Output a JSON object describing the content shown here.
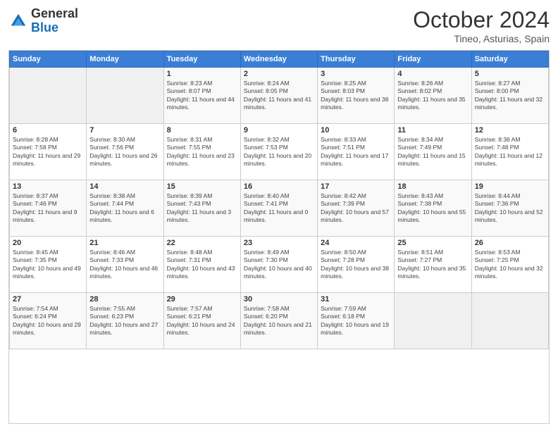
{
  "header": {
    "logo_general": "General",
    "logo_blue": "Blue",
    "month_year": "October 2024",
    "location": "Tineo, Asturias, Spain"
  },
  "days_of_week": [
    "Sunday",
    "Monday",
    "Tuesday",
    "Wednesday",
    "Thursday",
    "Friday",
    "Saturday"
  ],
  "weeks": [
    [
      {
        "day": "",
        "info": ""
      },
      {
        "day": "",
        "info": ""
      },
      {
        "day": "1",
        "info": "Sunrise: 8:23 AM\nSunset: 8:07 PM\nDaylight: 11 hours and 44 minutes."
      },
      {
        "day": "2",
        "info": "Sunrise: 8:24 AM\nSunset: 8:05 PM\nDaylight: 11 hours and 41 minutes."
      },
      {
        "day": "3",
        "info": "Sunrise: 8:25 AM\nSunset: 8:03 PM\nDaylight: 11 hours and 38 minutes."
      },
      {
        "day": "4",
        "info": "Sunrise: 8:26 AM\nSunset: 8:02 PM\nDaylight: 11 hours and 35 minutes."
      },
      {
        "day": "5",
        "info": "Sunrise: 8:27 AM\nSunset: 8:00 PM\nDaylight: 11 hours and 32 minutes."
      }
    ],
    [
      {
        "day": "6",
        "info": "Sunrise: 8:28 AM\nSunset: 7:58 PM\nDaylight: 11 hours and 29 minutes."
      },
      {
        "day": "7",
        "info": "Sunrise: 8:30 AM\nSunset: 7:56 PM\nDaylight: 11 hours and 26 minutes."
      },
      {
        "day": "8",
        "info": "Sunrise: 8:31 AM\nSunset: 7:55 PM\nDaylight: 11 hours and 23 minutes."
      },
      {
        "day": "9",
        "info": "Sunrise: 8:32 AM\nSunset: 7:53 PM\nDaylight: 11 hours and 20 minutes."
      },
      {
        "day": "10",
        "info": "Sunrise: 8:33 AM\nSunset: 7:51 PM\nDaylight: 11 hours and 17 minutes."
      },
      {
        "day": "11",
        "info": "Sunrise: 8:34 AM\nSunset: 7:49 PM\nDaylight: 11 hours and 15 minutes."
      },
      {
        "day": "12",
        "info": "Sunrise: 8:36 AM\nSunset: 7:48 PM\nDaylight: 11 hours and 12 minutes."
      }
    ],
    [
      {
        "day": "13",
        "info": "Sunrise: 8:37 AM\nSunset: 7:46 PM\nDaylight: 11 hours and 9 minutes."
      },
      {
        "day": "14",
        "info": "Sunrise: 8:38 AM\nSunset: 7:44 PM\nDaylight: 11 hours and 6 minutes."
      },
      {
        "day": "15",
        "info": "Sunrise: 8:39 AM\nSunset: 7:43 PM\nDaylight: 11 hours and 3 minutes."
      },
      {
        "day": "16",
        "info": "Sunrise: 8:40 AM\nSunset: 7:41 PM\nDaylight: 11 hours and 0 minutes."
      },
      {
        "day": "17",
        "info": "Sunrise: 8:42 AM\nSunset: 7:39 PM\nDaylight: 10 hours and 57 minutes."
      },
      {
        "day": "18",
        "info": "Sunrise: 8:43 AM\nSunset: 7:38 PM\nDaylight: 10 hours and 55 minutes."
      },
      {
        "day": "19",
        "info": "Sunrise: 8:44 AM\nSunset: 7:36 PM\nDaylight: 10 hours and 52 minutes."
      }
    ],
    [
      {
        "day": "20",
        "info": "Sunrise: 8:45 AM\nSunset: 7:35 PM\nDaylight: 10 hours and 49 minutes."
      },
      {
        "day": "21",
        "info": "Sunrise: 8:46 AM\nSunset: 7:33 PM\nDaylight: 10 hours and 46 minutes."
      },
      {
        "day": "22",
        "info": "Sunrise: 8:48 AM\nSunset: 7:31 PM\nDaylight: 10 hours and 43 minutes."
      },
      {
        "day": "23",
        "info": "Sunrise: 8:49 AM\nSunset: 7:30 PM\nDaylight: 10 hours and 40 minutes."
      },
      {
        "day": "24",
        "info": "Sunrise: 8:50 AM\nSunset: 7:28 PM\nDaylight: 10 hours and 38 minutes."
      },
      {
        "day": "25",
        "info": "Sunrise: 8:51 AM\nSunset: 7:27 PM\nDaylight: 10 hours and 35 minutes."
      },
      {
        "day": "26",
        "info": "Sunrise: 8:53 AM\nSunset: 7:25 PM\nDaylight: 10 hours and 32 minutes."
      }
    ],
    [
      {
        "day": "27",
        "info": "Sunrise: 7:54 AM\nSunset: 6:24 PM\nDaylight: 10 hours and 29 minutes."
      },
      {
        "day": "28",
        "info": "Sunrise: 7:55 AM\nSunset: 6:23 PM\nDaylight: 10 hours and 27 minutes."
      },
      {
        "day": "29",
        "info": "Sunrise: 7:57 AM\nSunset: 6:21 PM\nDaylight: 10 hours and 24 minutes."
      },
      {
        "day": "30",
        "info": "Sunrise: 7:58 AM\nSunset: 6:20 PM\nDaylight: 10 hours and 21 minutes."
      },
      {
        "day": "31",
        "info": "Sunrise: 7:59 AM\nSunset: 6:18 PM\nDaylight: 10 hours and 19 minutes."
      },
      {
        "day": "",
        "info": ""
      },
      {
        "day": "",
        "info": ""
      }
    ]
  ]
}
